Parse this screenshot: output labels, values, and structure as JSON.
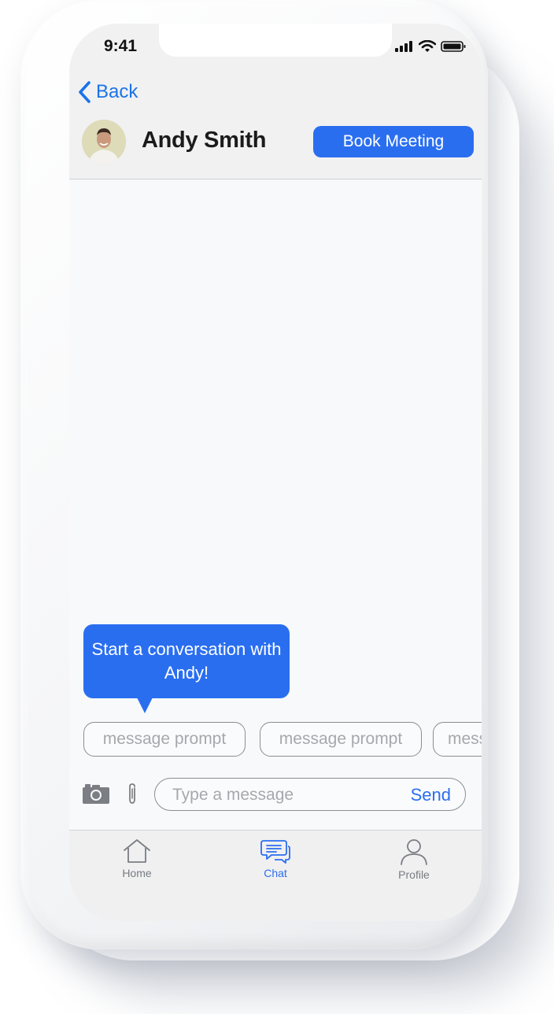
{
  "status_bar": {
    "time": "9:41"
  },
  "header": {
    "back_label": "Back",
    "contact_name": "Andy Smith",
    "book_meeting_label": "Book Meeting"
  },
  "chat": {
    "welcome_bubble": "Start a conversation with Andy!",
    "prompts": [
      "message prompt",
      "message prompt",
      "message prompt"
    ]
  },
  "composer": {
    "placeholder": "Type a message",
    "send_label": "Send"
  },
  "tabbar": {
    "tabs": [
      {
        "label": "Home",
        "icon": "home-icon",
        "active": false
      },
      {
        "label": "Chat",
        "icon": "chat-icon",
        "active": true
      },
      {
        "label": "Profile",
        "icon": "profile-icon",
        "active": false
      }
    ]
  },
  "colors": {
    "accent": "#2a6ef0",
    "back_link": "#1a73e8"
  }
}
